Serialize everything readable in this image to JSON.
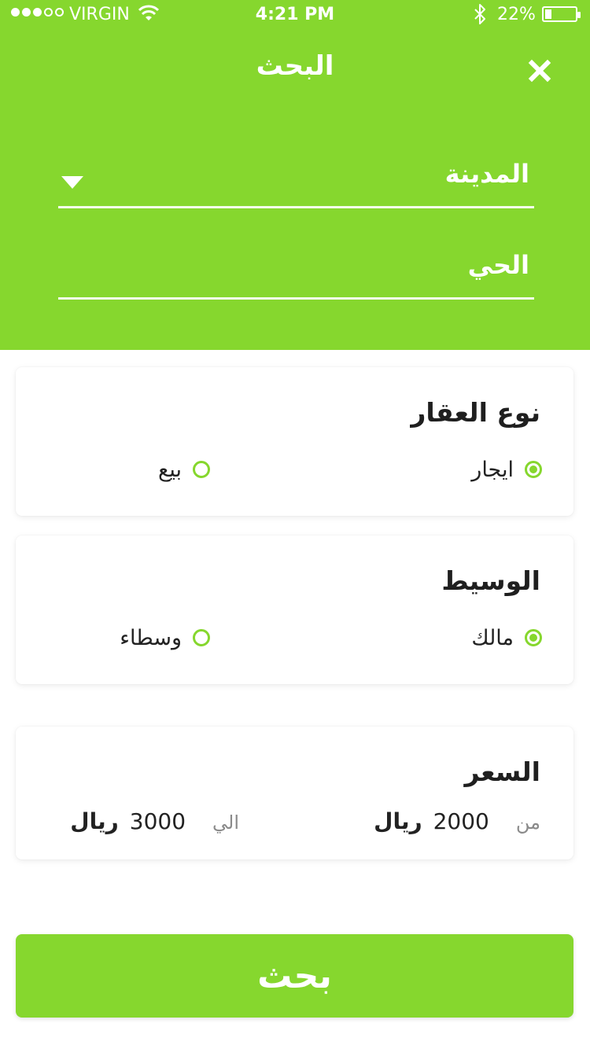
{
  "status_bar": {
    "carrier": "VIRGIN",
    "time": "4:21 PM",
    "battery_percent": "22%",
    "battery_level": 0.22,
    "signal_bars_filled": 3,
    "signal_bars_total": 5,
    "icons": [
      "wifi-icon",
      "bluetooth-icon",
      "battery-icon"
    ]
  },
  "header": {
    "title": "البحث",
    "close_icon": "close-icon",
    "city_field_label": "المدينة",
    "district_field_label": "الحي",
    "background_color": "#86d72e"
  },
  "property_type": {
    "title": "نوع العقار",
    "options": [
      {
        "label": "ايجار",
        "selected": true
      },
      {
        "label": "بيع",
        "selected": false
      }
    ]
  },
  "broker": {
    "title": "الوسيط",
    "options": [
      {
        "label": "مالك",
        "selected": true
      },
      {
        "label": "وسطاء",
        "selected": false
      }
    ]
  },
  "price": {
    "title": "السعر",
    "from_label": "من",
    "from_value": "2000",
    "from_currency": "ريال",
    "to_label": "الي",
    "to_value": "3000",
    "to_currency": "ريال"
  },
  "search_button": {
    "label": "بحث"
  },
  "accent_color": "#86d72e"
}
